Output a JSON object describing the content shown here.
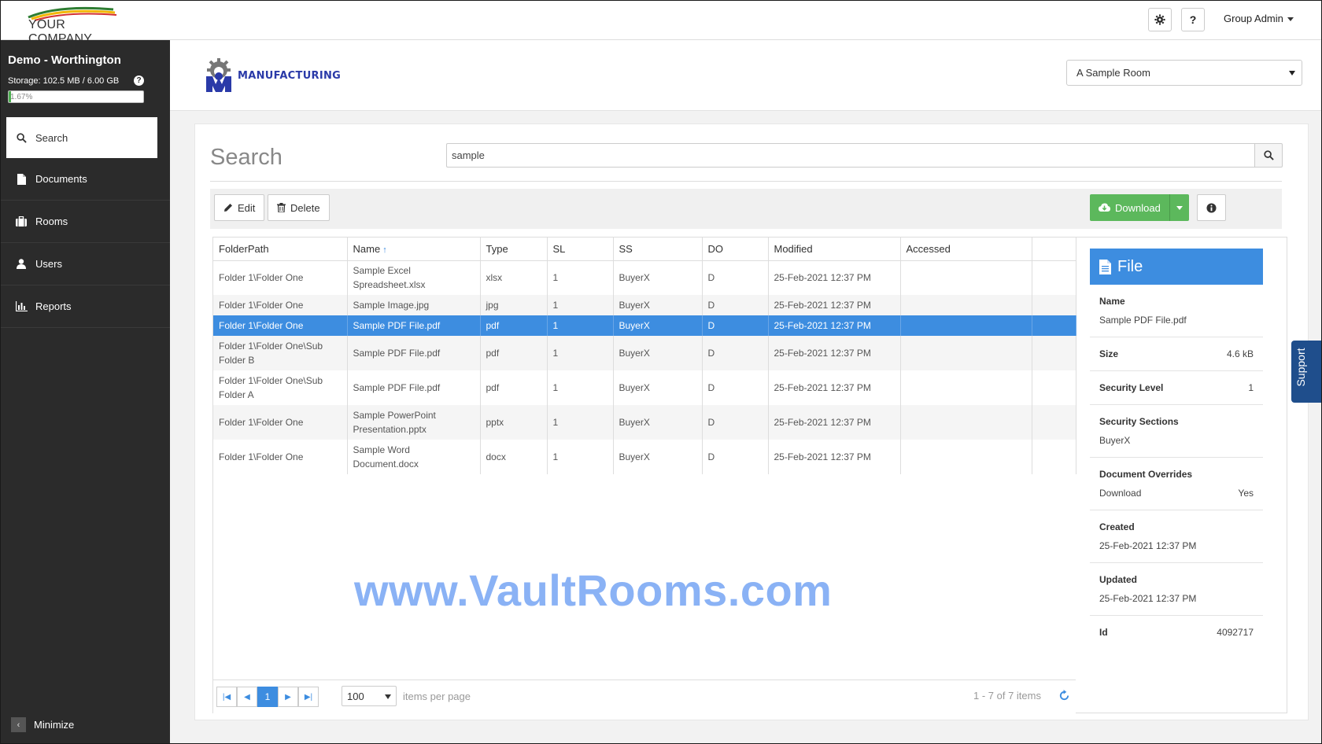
{
  "topbar": {
    "company": "YOUR COMPANY",
    "settings_icon": "gear-icon",
    "help_label": "?",
    "user_label": "Group Admin"
  },
  "sidebar": {
    "title": "Demo - Worthington",
    "storage_text": "Storage: 102.5 MB / 6.00 GB",
    "help_label": "?",
    "storage_percent_text": "1.67%",
    "storage_percent": 1.67,
    "items": [
      {
        "label": "Search",
        "icon": "search-icon",
        "active": true
      },
      {
        "label": "Documents",
        "icon": "document-icon"
      },
      {
        "label": "Rooms",
        "icon": "briefcase-icon"
      },
      {
        "label": "Users",
        "icon": "user-icon"
      },
      {
        "label": "Reports",
        "icon": "bar-chart-icon"
      }
    ],
    "minimize_label": "Minimize"
  },
  "header": {
    "brand": "MANUFACTURING",
    "room_selected": "A Sample Room"
  },
  "search": {
    "title": "Search",
    "query": "sample"
  },
  "toolbar": {
    "edit_label": "Edit",
    "delete_label": "Delete",
    "download_label": "Download"
  },
  "grid": {
    "columns": [
      "FolderPath",
      "Name",
      "Type",
      "SL",
      "SS",
      "DO",
      "Modified",
      "Accessed"
    ],
    "rows": [
      {
        "folder": "Folder 1\\Folder One",
        "name": "Sample Excel Spreadsheet.xlsx",
        "type": "xlsx",
        "sl": "1",
        "ss": "BuyerX",
        "do": "D",
        "modified": "25-Feb-2021 12:37 PM",
        "accessed": ""
      },
      {
        "folder": "Folder 1\\Folder One",
        "name": "Sample Image.jpg",
        "type": "jpg",
        "sl": "1",
        "ss": "BuyerX",
        "do": "D",
        "modified": "25-Feb-2021 12:37 PM",
        "accessed": ""
      },
      {
        "folder": "Folder 1\\Folder One",
        "name": "Sample PDF File.pdf",
        "type": "pdf",
        "sl": "1",
        "ss": "BuyerX",
        "do": "D",
        "modified": "25-Feb-2021 12:37 PM",
        "accessed": ""
      },
      {
        "folder": "Folder 1\\Folder One\\Sub Folder B",
        "name": "Sample PDF File.pdf",
        "type": "pdf",
        "sl": "1",
        "ss": "BuyerX",
        "do": "D",
        "modified": "25-Feb-2021 12:37 PM",
        "accessed": ""
      },
      {
        "folder": "Folder 1\\Folder One\\Sub Folder A",
        "name": "Sample PDF File.pdf",
        "type": "pdf",
        "sl": "1",
        "ss": "BuyerX",
        "do": "D",
        "modified": "25-Feb-2021 12:37 PM",
        "accessed": ""
      },
      {
        "folder": "Folder 1\\Folder One",
        "name": "Sample PowerPoint Presentation.pptx",
        "type": "pptx",
        "sl": "1",
        "ss": "BuyerX",
        "do": "D",
        "modified": "25-Feb-2021 12:37 PM",
        "accessed": ""
      },
      {
        "folder": "Folder 1\\Folder One",
        "name": "Sample Word Document.docx",
        "type": "docx",
        "sl": "1",
        "ss": "BuyerX",
        "do": "D",
        "modified": "25-Feb-2021 12:37 PM",
        "accessed": ""
      }
    ],
    "selected_row": 2
  },
  "pager": {
    "current_page": "1",
    "page_size": "100",
    "items_per_page_label": "items per page",
    "info": "1 - 7 of 7 items"
  },
  "details": {
    "header": "File",
    "name_label": "Name",
    "name_value": "Sample PDF File.pdf",
    "size_label": "Size",
    "size_value": "4.6 kB",
    "security_level_label": "Security Level",
    "security_level_value": "1",
    "security_sections_label": "Security Sections",
    "security_sections_value": "BuyerX",
    "overrides_label": "Document Overrides",
    "overrides_key": "Download",
    "overrides_value": "Yes",
    "created_label": "Created",
    "created_value": "25-Feb-2021 12:37 PM",
    "updated_label": "Updated",
    "updated_value": "25-Feb-2021 12:37 PM",
    "id_label": "Id",
    "id_value": "4092717"
  },
  "watermark": "www.VaultRooms.com",
  "support_label": "Support",
  "colors": {
    "sidebar_bg": "#2b2b2b",
    "accent_blue": "#3d8de0",
    "download_green": "#5cb85c",
    "support_blue": "#1f4e8c"
  }
}
